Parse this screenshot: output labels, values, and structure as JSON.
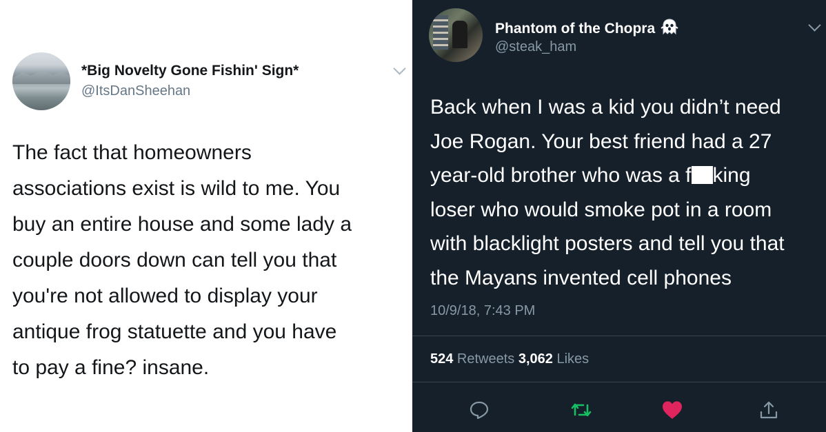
{
  "left_tweet": {
    "display_name": "*Big Novelty Gone Fishin' Sign*",
    "handle": "@ItsDanSheehan",
    "text": "The fact that homeowners\nassociations exist is wild to me. You\nbuy an entire house and some lady a\ncouple doors down can tell you that\nyou're not allowed to display your\nantique frog statuette and you have\nto pay a fine? insane.",
    "menu_icon": "chevron-down-icon"
  },
  "right_tweet": {
    "display_name": "Phantom of the Chopra",
    "name_emoji_icon": "ghost-icon",
    "handle": "@steak_ham",
    "text_before_censor": "Back when I was a kid you didn’t need\nJoe Rogan. Your best friend had a 27\nyear-old brother who was a f",
    "text_after_censor": "king\nloser who would smoke pot in a room\nwith blacklight posters and tell you that\nthe Mayans invented cell phones",
    "timestamp": "10/9/18, 7:43 PM",
    "retweet_count": "524",
    "retweet_label": " Retweets ",
    "like_count": "3,062",
    "like_label": " Likes",
    "actions": [
      "reply-icon",
      "retweet-icon",
      "heart-icon",
      "share-icon"
    ],
    "colors": {
      "background": "#15202b",
      "retweet": "#17bf63",
      "like": "#e0245e",
      "secondary_text": "#8899a6"
    }
  }
}
